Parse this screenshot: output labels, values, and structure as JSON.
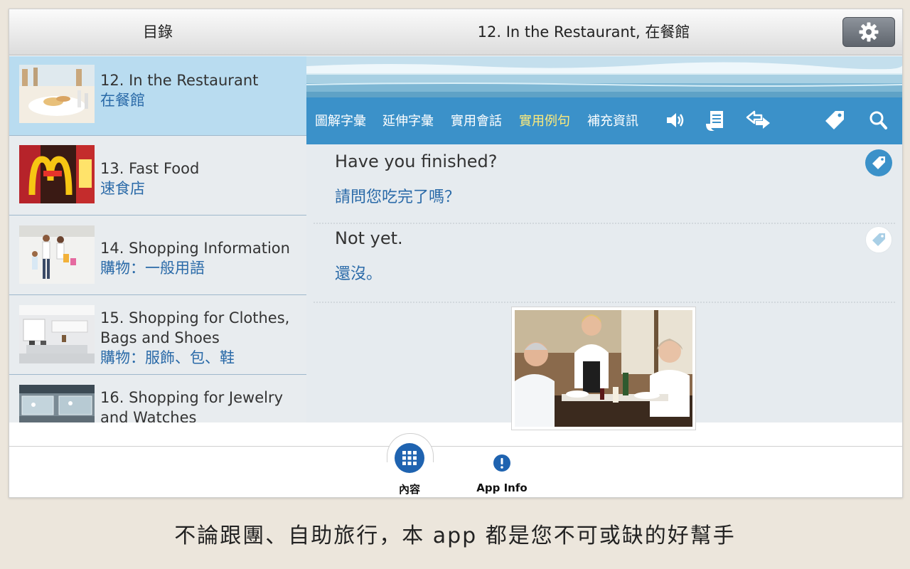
{
  "header": {
    "left_title": "目錄",
    "center_title": "12. In the Restaurant, 在餐館",
    "settings_icon": "gear-icon"
  },
  "sidebar": {
    "items": [
      {
        "en_lines": [
          "12. In the Restaurant"
        ],
        "zh": "在餐館",
        "selected": true
      },
      {
        "en_lines": [
          "13. Fast Food"
        ],
        "zh": "速食店",
        "selected": false
      },
      {
        "en_lines": [
          "14. Shopping Information"
        ],
        "zh": "購物：一般用語",
        "selected": false
      },
      {
        "en_lines": [
          "15. Shopping for Clothes,",
          "Bags and Shoes"
        ],
        "zh": "購物：服飾、包、鞋",
        "selected": false
      },
      {
        "en_lines": [
          "16. Shopping for Jewelry",
          "and Watches"
        ],
        "zh": "",
        "selected": false
      }
    ]
  },
  "toolbar": {
    "tabs": [
      "圖解字彙",
      "延伸字彙",
      "實用會話",
      "實用例句",
      "補充資訊"
    ],
    "active_tab": "實用例句",
    "icons": [
      "speaker-icon",
      "document-icon",
      "swap-icon",
      "tag-icon",
      "search-icon"
    ]
  },
  "phrases": [
    {
      "en": "Have you finished?",
      "zh": "請問您吃完了嗎？",
      "tagged": true
    },
    {
      "en": "Not yet.",
      "zh": "還沒。",
      "tagged": false
    }
  ],
  "bottom_nav": {
    "contents_label": "內容",
    "info_label": "App Info"
  },
  "caption": "不論跟團、自助旅行，本 app 都是您不可或缺的好幫手",
  "colors": {
    "accent": "#3b91c9",
    "active_tab": "#ffeb7a",
    "selected_row": "#b9dcf0",
    "chinese_text": "#2a6aa8",
    "nav_button": "#1f63b0"
  }
}
